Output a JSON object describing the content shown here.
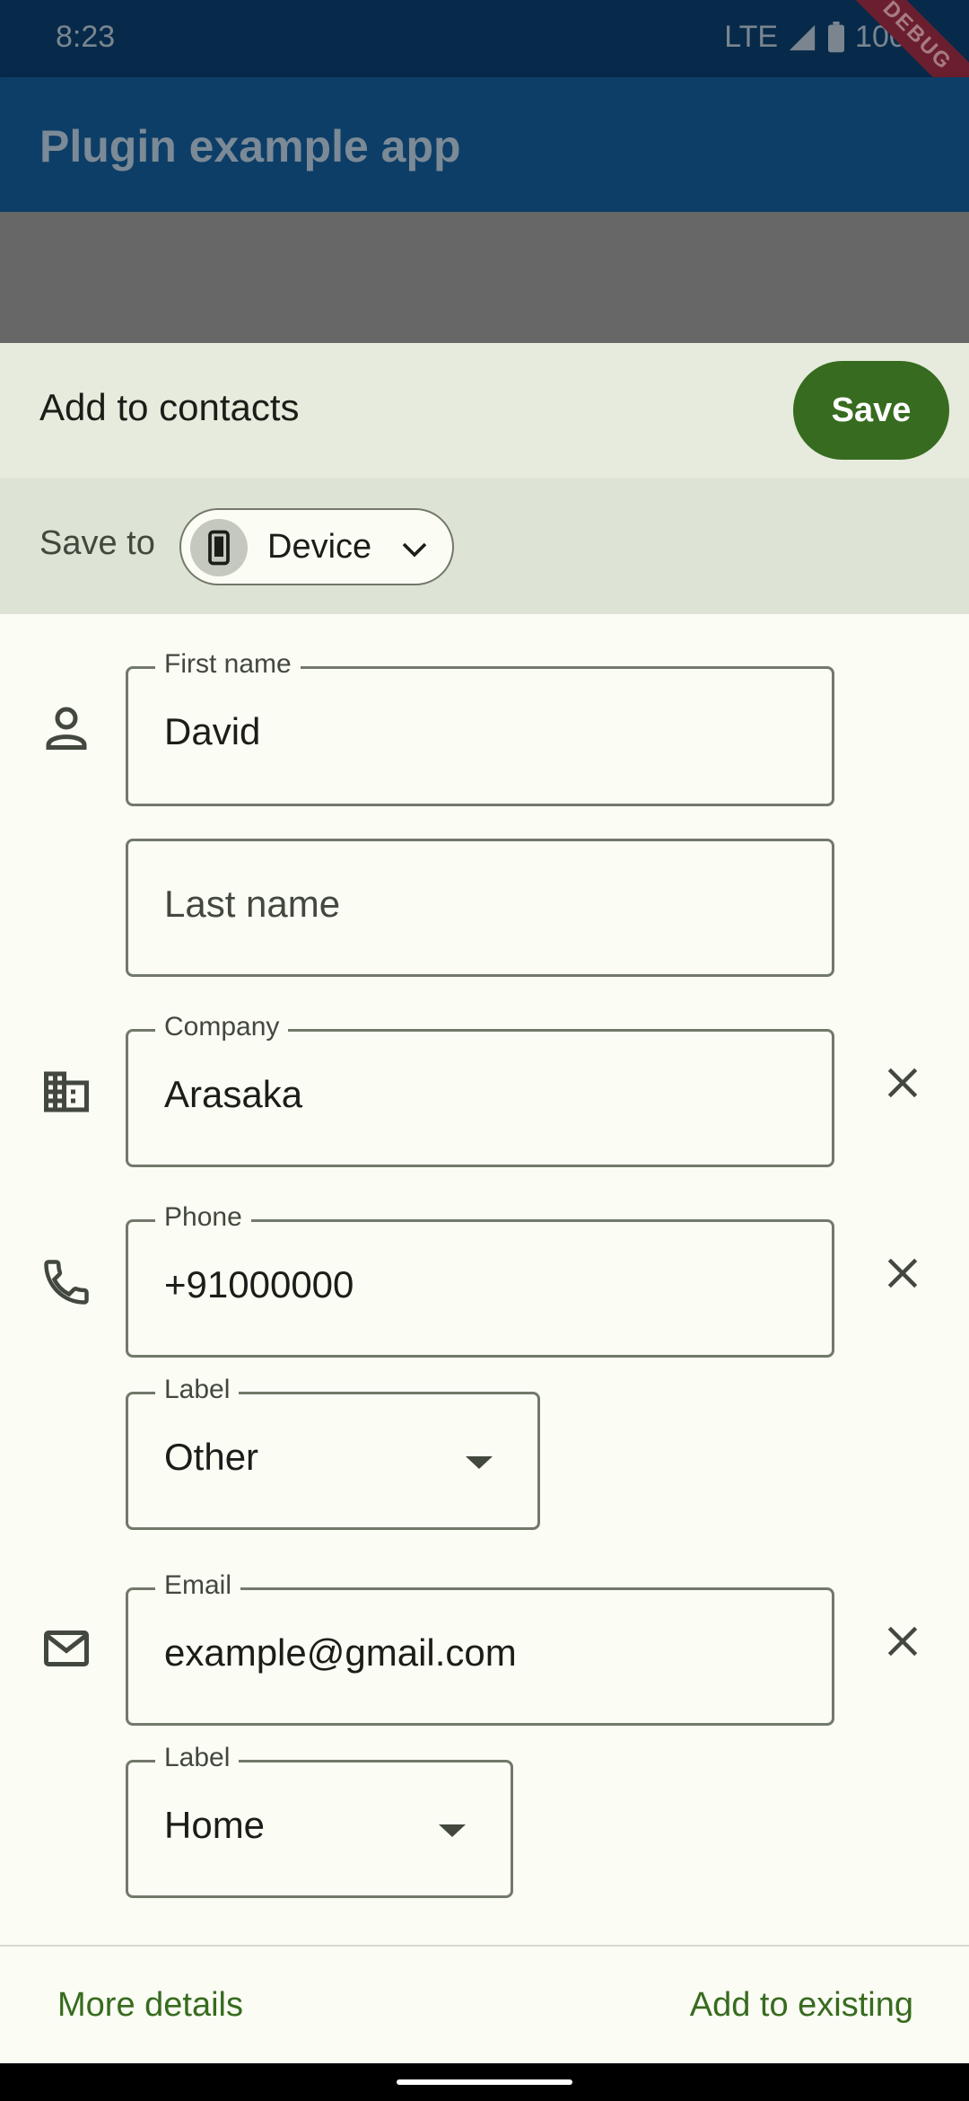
{
  "status_bar": {
    "time": "8:23",
    "network": "LTE",
    "battery": "100%",
    "debug_banner": "DEBUG"
  },
  "app_bar": {
    "title": "Plugin example app"
  },
  "sheet": {
    "title": "Add to contacts",
    "save_label": "Save",
    "save_to_label": "Save to",
    "account": "Device"
  },
  "form": {
    "first_name": {
      "label": "First name",
      "value": "David"
    },
    "last_name": {
      "placeholder": "Last name"
    },
    "company": {
      "label": "Company",
      "value": "Arasaka"
    },
    "phone": {
      "label": "Phone",
      "value": "+91000000"
    },
    "phone_label": {
      "label": "Label",
      "value": "Other"
    },
    "email": {
      "label": "Email",
      "value": "example@gmail.com"
    },
    "email_label": {
      "label": "Label",
      "value": "Home"
    }
  },
  "bottom": {
    "more_details": "More details",
    "add_to_existing": "Add to existing"
  },
  "colors": {
    "primary": "#376b1f",
    "app_bar": "#0d3e67",
    "surface": "#fbfcf4"
  }
}
